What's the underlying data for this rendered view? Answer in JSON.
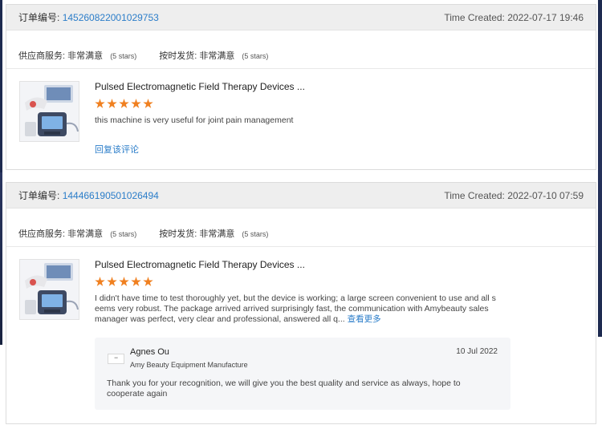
{
  "labels": {
    "order_no": "订单编号:",
    "time_created": "Time Created:",
    "supplier_service": "供应商服务:",
    "on_time_shipping": "按时发货:",
    "rating_value": "非常满意",
    "rating_stars": "(5 stars)"
  },
  "colors": {
    "link": "#2b7dc9",
    "star": "#f08020"
  },
  "reviews": [
    {
      "order_no": "145260822001029753",
      "time_created": "2022-07-17 19:46",
      "product_title": "Pulsed Electromagnetic Field Therapy Devices ...",
      "stars": 5,
      "comment": "this machine is very useful for joint pain management",
      "reply_link": "回复该评论"
    },
    {
      "order_no": "144466190501026494",
      "time_created": "2022-07-10 07:59",
      "product_title": "Pulsed Electromagnetic Field Therapy Devices ...",
      "stars": 5,
      "comment": "I didn't have time to test thoroughly yet, but the device is working; a large screen convenient to use and all s eems very robust. The package arrived arrived surprisingly fast, the communication with Amybeauty sales manager was perfect, very clear and professional, answered all q...",
      "more_link": "查看更多",
      "supplier_reply": {
        "name": "Agnes Ou",
        "company": "Amy Beauty Equipment Manufacture",
        "date": "10 Jul 2022",
        "text": "Thank you for your recognition, we will give you the best quality and service as always, hope to cooperate again"
      }
    }
  ]
}
